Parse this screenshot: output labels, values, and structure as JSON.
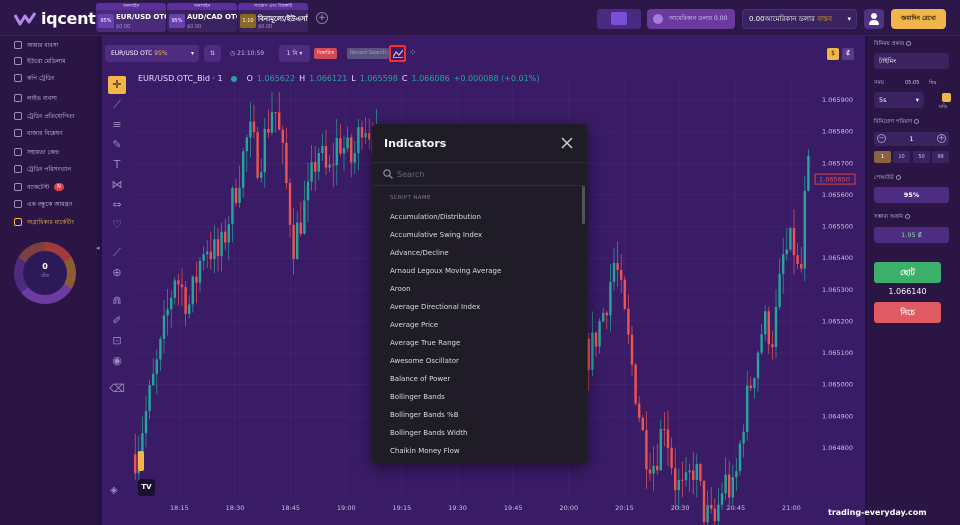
{
  "brand": {
    "name": "iqcent"
  },
  "asset_tabs": [
    {
      "header": "অনলাইন",
      "payout": "95%",
      "name": "EUR/USD OTC",
      "price": "$0.00",
      "active": true
    },
    {
      "header": "অনলাইন",
      "payout": "95%",
      "name": "AUD/CAD OTC",
      "price": "$0.00",
      "active": false
    },
    {
      "header": "সংক্ষেপ এবং বিকল্পটি",
      "payout": "1:10",
      "name": "বিনামূল্যে/ইউএসডিটি",
      "price": "$0.00",
      "active": false
    }
  ],
  "header": {
    "demo_balance": "আমেরিকান ডলার 0.00",
    "account_balance": "0.00আমেরিকান ডলার",
    "account_type": "বাস্তব",
    "deposit": "জমাদিন রেখো"
  },
  "sidebar": {
    "items": [
      {
        "label": "আমার ব্যবসা",
        "icon": "briefcase-icon"
      },
      {
        "label": "ইউরো মেডিলাম",
        "icon": "euro-icon"
      },
      {
        "label": "কপি ট্রেডিং",
        "icon": "copy-icon"
      },
      {
        "label": "লাইভ ব্যবসা",
        "icon": "chart-icon"
      },
      {
        "label": "ট্রেডিং প্রতিযোগিতা",
        "icon": "trophy-icon"
      },
      {
        "label": "বাজার বিশ্লেষণ",
        "icon": "analysis-icon"
      },
      {
        "label": "সহায়তা কেন্দ্র",
        "icon": "help-icon"
      },
      {
        "label": "ট্রেডিং পরিসংখ্যান",
        "icon": "stats-icon"
      },
      {
        "label": "ব্যাকটেস্ট",
        "icon": "backtest-icon",
        "badge": "N"
      },
      {
        "label": "এক বন্ধুকে আমন্ত্রণ",
        "icon": "invite-icon"
      },
      {
        "label": "অগ্রাধিকার মাৰ্কেটিং",
        "icon": "priority-icon",
        "highlight": true
      }
    ],
    "donut_value": "0",
    "donut_label": "টেড"
  },
  "chart_toolbar": {
    "asset": "EUR/USD OTC",
    "asset_payout": "95%",
    "time": "21:10:59",
    "timeframe": "1 মি",
    "red_chip": "বিস্তারিত",
    "grey_chip": "Recent Search",
    "right_a": "$",
    "right_b": "₡"
  },
  "legend": {
    "symbol": "EUR/USD.OTC_Bid · 1",
    "o_label": "O",
    "o": "1.065622",
    "h_label": "H",
    "h": "1.066121",
    "l_label": "L",
    "l": "1.065598",
    "c_label": "C",
    "c": "1.066086",
    "change": "+0.000088 (+0.01%)"
  },
  "chart_data": {
    "type": "candlestick",
    "y_ticks": [
      "1.065900",
      "1.065800",
      "1.065700",
      "1.065600",
      "1.065500",
      "1.065400",
      "1.065300",
      "1.065200",
      "1.065100",
      "1.065000",
      "1.064900",
      "1.064800"
    ],
    "x_ticks": [
      "18:15",
      "18:30",
      "18:45",
      "19:00",
      "19:15",
      "19:30",
      "19:45",
      "20:00",
      "20:15",
      "20:30",
      "20:45",
      "21:00"
    ],
    "price_tag": "1.065650",
    "up_color": "#26a69a",
    "down_color": "#ef5350",
    "grid": true
  },
  "modal": {
    "title": "Indicators",
    "search_placeholder": "Search",
    "section_head": "SCRIPT NAME",
    "items": [
      "Accumulation/Distribution",
      "Accumulative Swing Index",
      "Advance/Decline",
      "Arnaud Legoux Moving Average",
      "Aroon",
      "Average Directional Index",
      "Average Price",
      "Average True Range",
      "Awesome Oscillator",
      "Balance of Power",
      "Bollinger Bands",
      "Bollinger Bands %B",
      "Bollinger Bands Width",
      "Chaikin Money Flow"
    ]
  },
  "trade_panel": {
    "asset_label": "বিনিময় প্রকার",
    "asset_value": "টাইমিং",
    "time_label": "সময়",
    "time_value": "5s",
    "time_extra": "05:05",
    "time_note": "স্থির",
    "time_note2": "ঘড়ি",
    "amount_label": "বিনিয়োগ পরিমাণ",
    "amount_value": "1",
    "quick": [
      "1",
      "10",
      "50",
      "99"
    ],
    "payout_label": "পেআউট",
    "payout_value": "95%",
    "profit_label": "সম্ভাব্য অর্জন",
    "profit_value": "1.95 ₡",
    "up_label": "ছোট",
    "current_price": "1.066140",
    "down_label": "নিচে"
  },
  "watermark": "trading-everyday.com"
}
